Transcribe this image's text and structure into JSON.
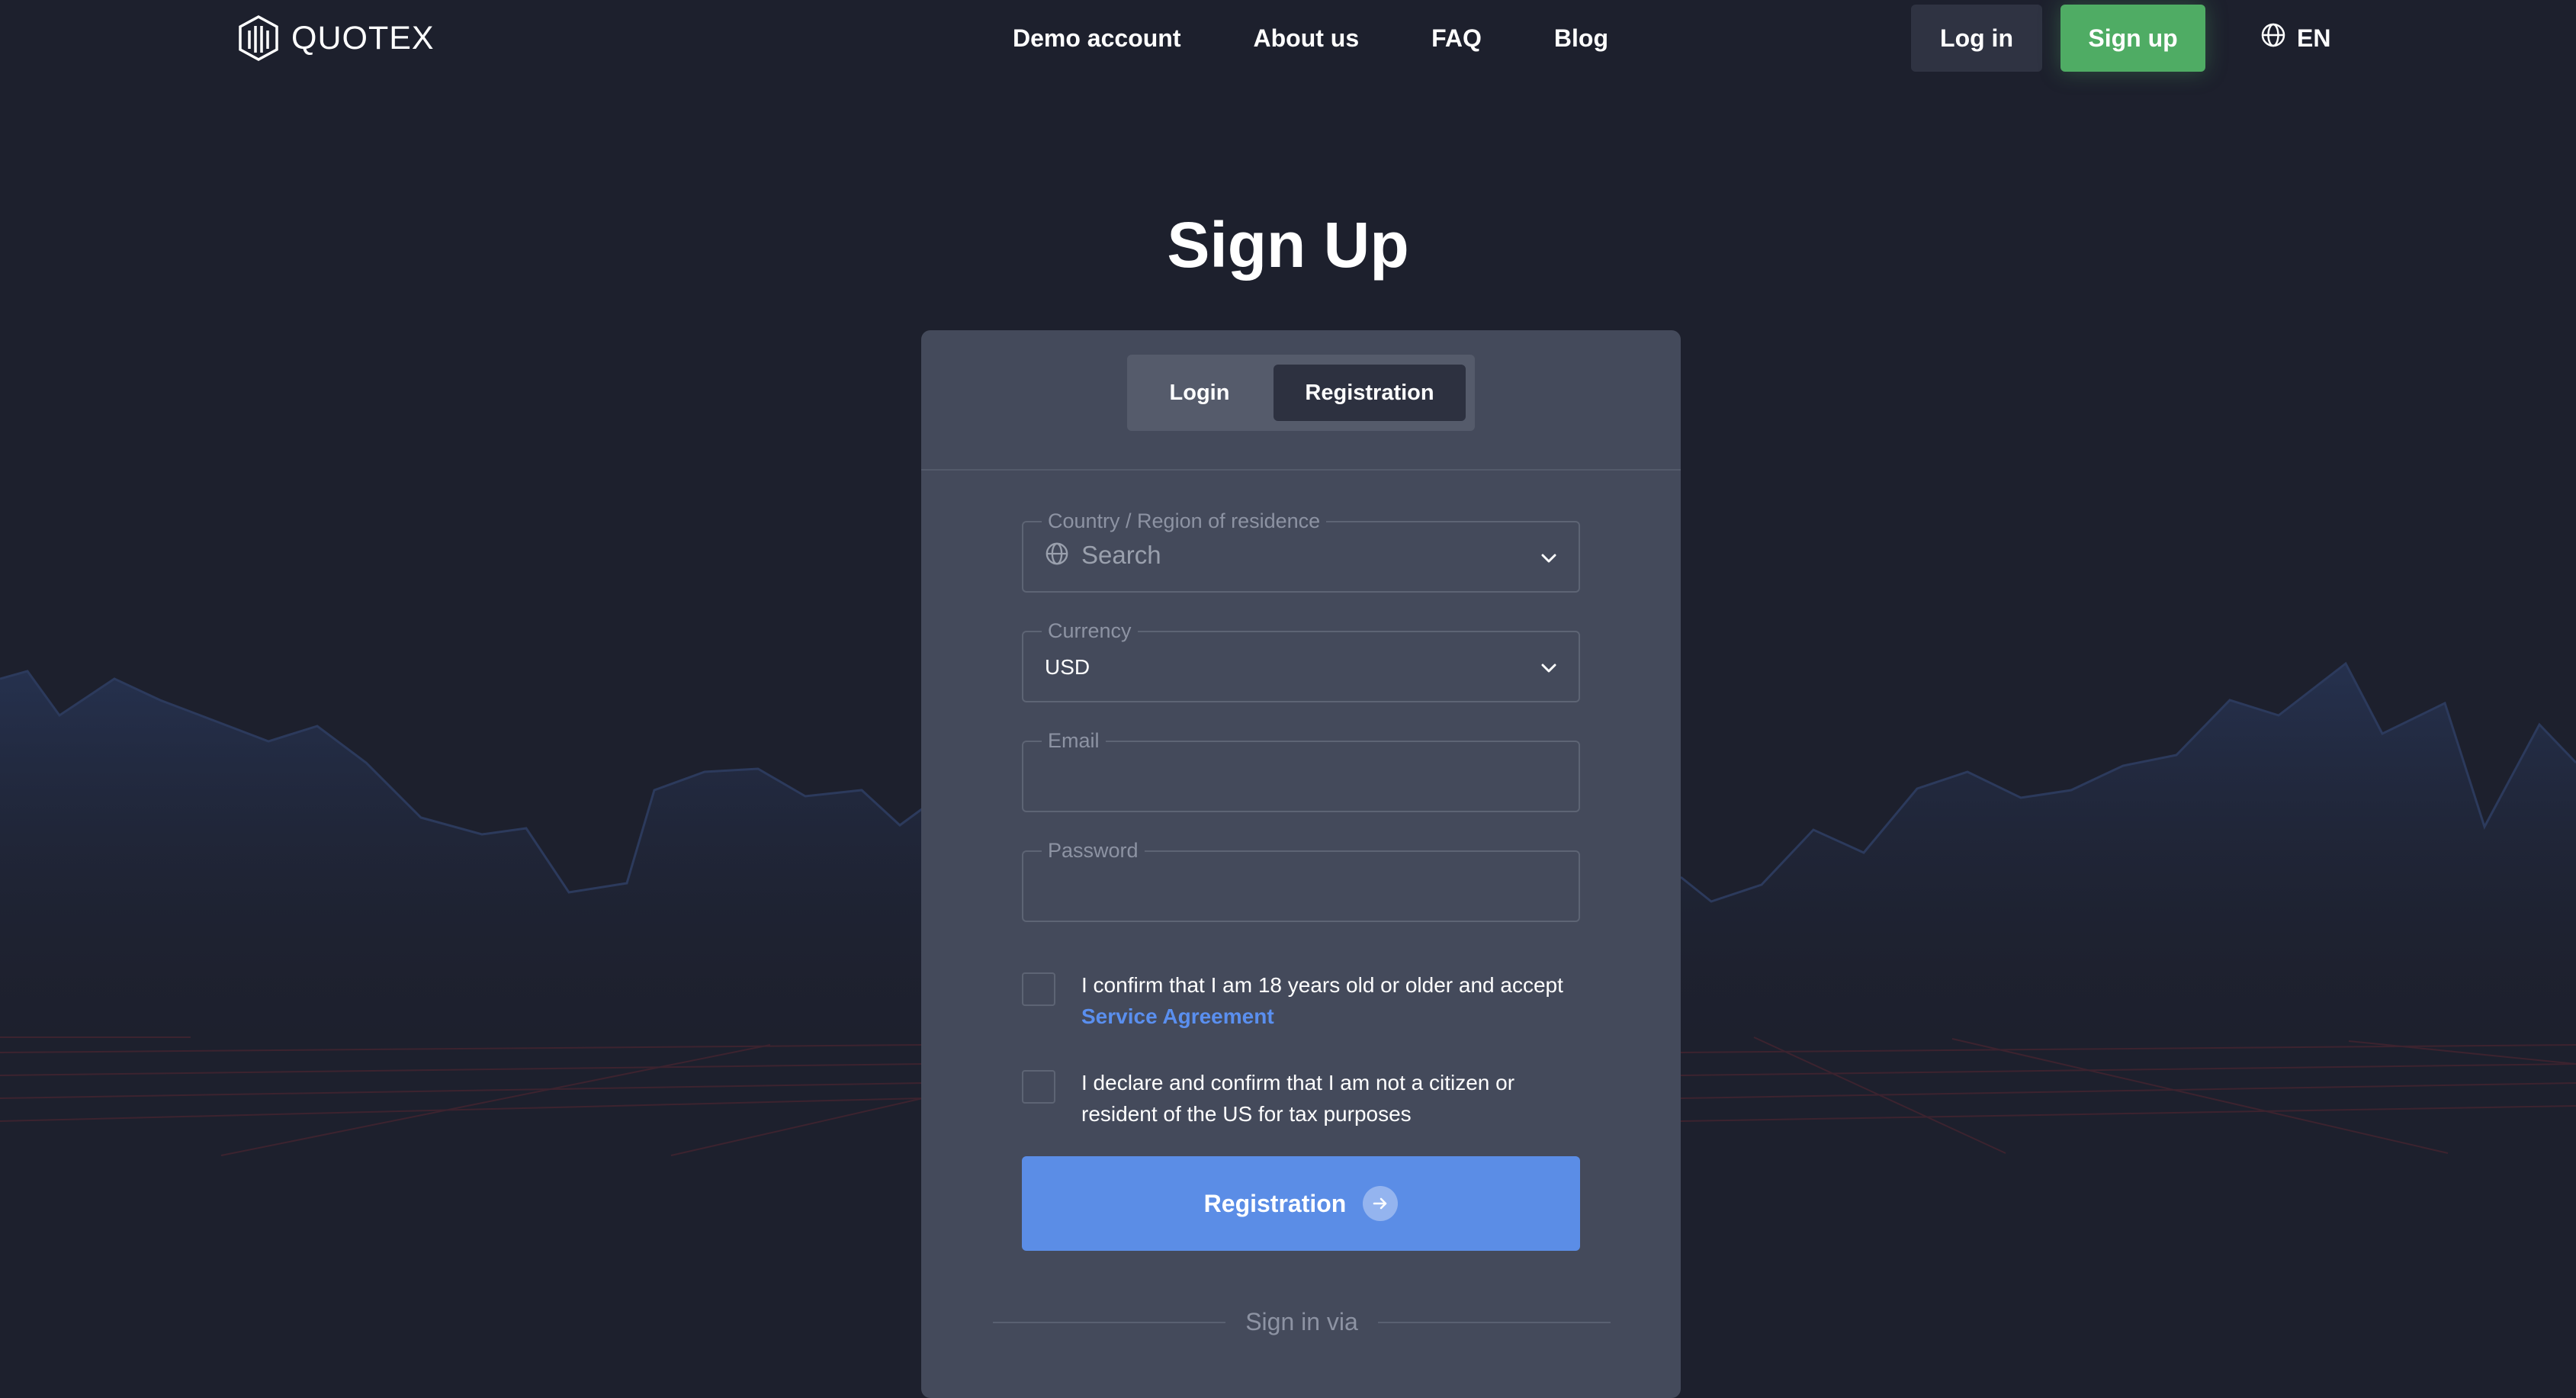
{
  "brand": {
    "name": "QUOTEX",
    "icon": "quotex-logo-icon"
  },
  "nav": {
    "items": [
      {
        "label": "Demo account"
      },
      {
        "label": "About us"
      },
      {
        "label": "FAQ"
      },
      {
        "label": "Blog"
      }
    ],
    "login_label": "Log in",
    "signup_label": "Sign up",
    "language": "EN",
    "language_icon": "globe-icon"
  },
  "page": {
    "title": "Sign Up"
  },
  "auth_tabs": {
    "items": [
      {
        "label": "Login",
        "active": false
      },
      {
        "label": "Registration",
        "active": true
      }
    ]
  },
  "form": {
    "country": {
      "label": "Country / Region of residence",
      "placeholder": "Search",
      "icon": "globe-icon"
    },
    "currency": {
      "label": "Currency",
      "value": "USD"
    },
    "email": {
      "label": "Email",
      "value": ""
    },
    "password": {
      "label": "Password",
      "value": ""
    },
    "age_confirm": {
      "text": "I confirm that I am 18 years old or older and accept",
      "link": "Service Agreement",
      "checked": false
    },
    "tax_confirm": {
      "text": "I declare and confirm that I am not a citizen or resident of the US for tax purposes",
      "checked": false
    },
    "submit_label": "Registration",
    "signin_via": "Sign in via"
  },
  "colors": {
    "background": "#1d202d",
    "card": "#444a5b",
    "accent_green": "#4fac64",
    "accent_blue": "#5b8de6",
    "link": "#5a8fef"
  }
}
